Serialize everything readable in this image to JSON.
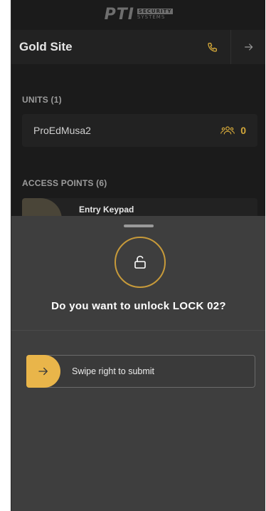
{
  "brand": {
    "logo": "PTI",
    "line1": "SECURITY",
    "line2": "SYSTEMS"
  },
  "header": {
    "title": "Gold Site",
    "call_icon": "phone-icon",
    "logout_icon": "arrow-right-icon"
  },
  "units": {
    "label": "UNITS (1)",
    "items": [
      {
        "name": "ProEdMusa2",
        "count": "0",
        "icon": "users-icon"
      }
    ]
  },
  "access_points": {
    "label": "ACCESS POINTS (6)",
    "items": [
      {
        "name": "Entry Keypad"
      }
    ]
  },
  "sheet": {
    "question": "Do you want to unlock LOCK 02?",
    "lock_icon": "unlock-icon",
    "swipe_label": "Swipe right to submit",
    "swipe_icon": "arrow-right-icon"
  },
  "colors": {
    "accent": "#d4a83a",
    "knob": "#e9b54a",
    "sheet": "#3e3e3e",
    "background": "#1b1b1b"
  }
}
